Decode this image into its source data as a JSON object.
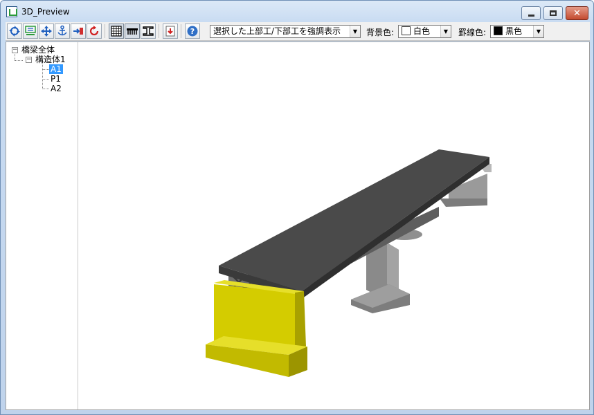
{
  "window": {
    "title": "3D_Preview"
  },
  "toolbar": {
    "view_mode_select": "選択した上部工/下部工を強調表示",
    "background_label": "背景色:",
    "background_value": "白色",
    "background_color": "#ffffff",
    "line_color_label": "罫線色:",
    "line_color_value": "黒色",
    "line_color": "#000000"
  },
  "tree": {
    "root": "橋梁全体",
    "structure": "構造体1",
    "items": [
      "A1",
      "P1",
      "A2"
    ],
    "selected": "A1"
  },
  "colors": {
    "deck": "#4a4a4a",
    "pier": "#8c8c8c",
    "abutment_selected": "#d4cc00"
  }
}
